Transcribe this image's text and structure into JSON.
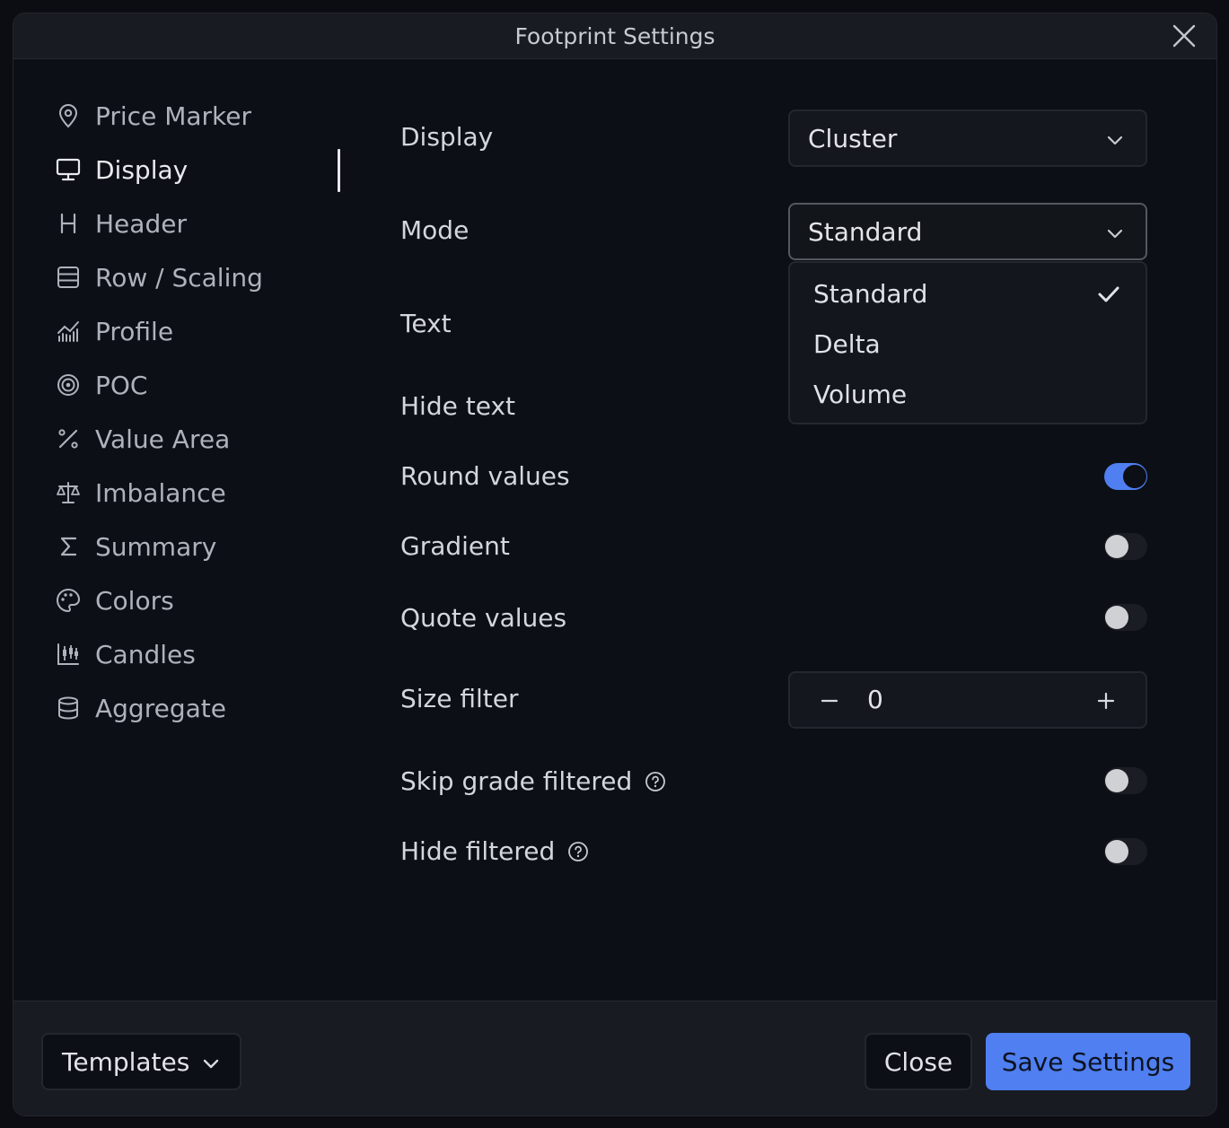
{
  "dialog": {
    "title": "Footprint Settings"
  },
  "sidebar": {
    "items": [
      {
        "label": "Price Marker",
        "icon": "map-pin-icon"
      },
      {
        "label": "Display",
        "icon": "monitor-icon",
        "active": true
      },
      {
        "label": "Header",
        "icon": "heading-icon"
      },
      {
        "label": "Row / Scaling",
        "icon": "rows-icon"
      },
      {
        "label": "Profile",
        "icon": "chart-bars-icon"
      },
      {
        "label": "POC",
        "icon": "target-icon"
      },
      {
        "label": "Value Area",
        "icon": "percent-icon"
      },
      {
        "label": "Imbalance",
        "icon": "scale-icon"
      },
      {
        "label": "Summary",
        "icon": "sigma-icon"
      },
      {
        "label": "Colors",
        "icon": "palette-icon"
      },
      {
        "label": "Candles",
        "icon": "candles-icon"
      },
      {
        "label": "Aggregate",
        "icon": "database-icon"
      }
    ]
  },
  "settings": {
    "display": {
      "label": "Display",
      "value": "Cluster"
    },
    "mode": {
      "label": "Mode",
      "value": "Standard",
      "options": [
        "Standard",
        "Delta",
        "Volume"
      ],
      "selected": "Standard"
    },
    "text": {
      "label": "Text"
    },
    "hide_text": {
      "label": "Hide text"
    },
    "round_values": {
      "label": "Round values",
      "on": true
    },
    "gradient": {
      "label": "Gradient",
      "on": false
    },
    "quote_values": {
      "label": "Quote values",
      "on": false
    },
    "size_filter": {
      "label": "Size filter",
      "value": "0",
      "minus": "−",
      "plus": "+"
    },
    "skip_grade_filtered": {
      "label": "Skip grade filtered",
      "on": false
    },
    "hide_filtered": {
      "label": "Hide filtered",
      "on": false
    }
  },
  "footer": {
    "templates_label": "Templates",
    "close_label": "Close",
    "save_label": "Save Settings"
  },
  "colors": {
    "accent": "#4f7ff0",
    "background": "#0c0f15",
    "panel": "#181b21"
  }
}
